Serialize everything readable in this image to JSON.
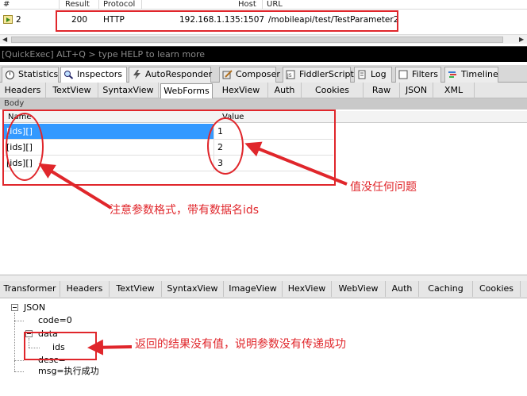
{
  "session_list": {
    "headers": [
      "#",
      "Result",
      "Protocol",
      "Host",
      "URL"
    ],
    "row": {
      "number": "2",
      "result": "200",
      "protocol": "HTTP",
      "host": "192.168.1.135:1507",
      "url": "/mobileapi/test/TestParameter2"
    }
  },
  "quickexec": {
    "placeholder": "[QuickExec] ALT+Q > type HELP to learn more"
  },
  "main_tabs": [
    {
      "label": "Statistics",
      "icon": "stopwatch-icon"
    },
    {
      "label": "Inspectors",
      "icon": "magnifier-icon"
    },
    {
      "label": "AutoResponder",
      "icon": "lightning-icon"
    },
    {
      "label": "Composer",
      "icon": "pencil-icon"
    },
    {
      "label": "FiddlerScript",
      "icon": "script-icon"
    },
    {
      "label": "Log",
      "icon": "log-icon"
    },
    {
      "label": "Filters",
      "icon": "checkbox-icon"
    },
    {
      "label": "Timeline",
      "icon": "timeline-icon"
    }
  ],
  "request_tabs": [
    "Headers",
    "TextView",
    "SyntaxView",
    "WebForms",
    "HexView",
    "Auth",
    "Cookies",
    "Raw",
    "JSON",
    "XML"
  ],
  "body_section": {
    "label": "Body",
    "columns": [
      "Name",
      "Value"
    ],
    "rows": [
      {
        "name": "[ids][]",
        "value": "1"
      },
      {
        "name": "[ids][]",
        "value": "2"
      },
      {
        "name": "[ids][]",
        "value": "3"
      }
    ]
  },
  "response_tabs": [
    "Transformer",
    "Headers",
    "TextView",
    "SyntaxView",
    "ImageView",
    "HexView",
    "WebView",
    "Auth",
    "Caching",
    "Cookies"
  ],
  "json_tree": {
    "root": "JSON",
    "code": "code=0",
    "data": "data",
    "ids": "ids",
    "desc": "desc=",
    "msg": "msg=执行成功"
  },
  "annotations": {
    "value_note": "值没任何问题",
    "format_note": "注意参数格式，带有数据名ids",
    "result_note": "返回的结果没有值，说明参数没有传递成功"
  },
  "colors": {
    "annotation": "#e0262b",
    "selection": "#3399ff",
    "quickexec_bg": "#000000"
  }
}
